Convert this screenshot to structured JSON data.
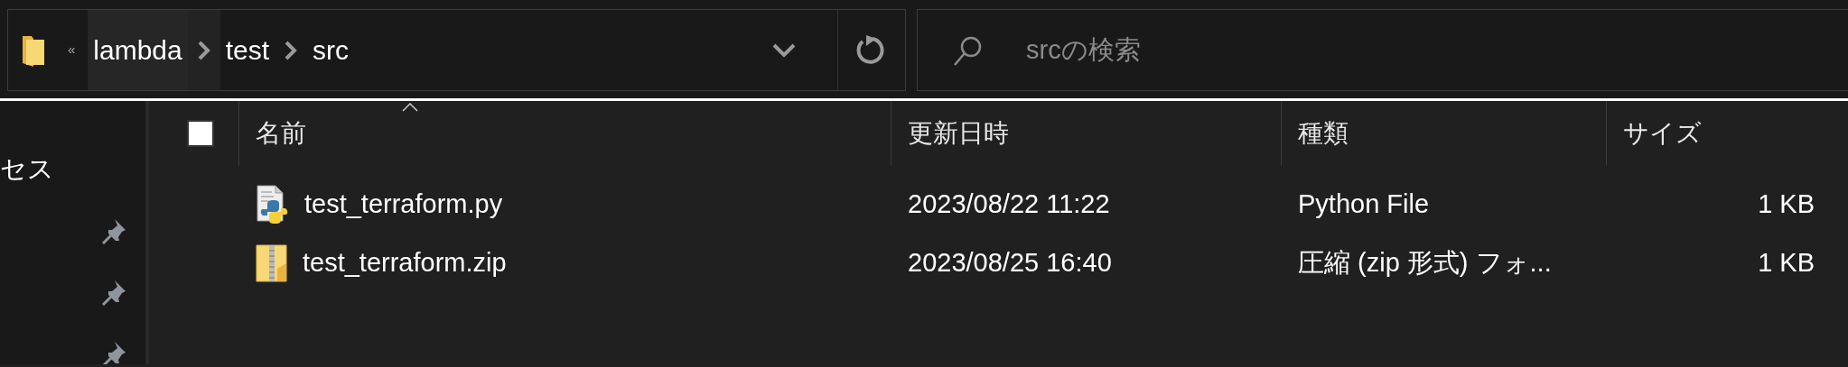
{
  "address_bar": {
    "overflow": "«",
    "breadcrumbs": [
      {
        "label": "lambda",
        "hovered": true
      },
      {
        "label": "test",
        "hovered": false
      },
      {
        "label": "src",
        "hovered": false
      }
    ]
  },
  "search": {
    "placeholder": "srcの検索"
  },
  "sidebar": {
    "items": [
      {
        "label": "セス",
        "pinned": false
      },
      {
        "pinned": true
      },
      {
        "pinned": true
      },
      {
        "pinned": true
      }
    ]
  },
  "select_all": {
    "checked": false
  },
  "columns": [
    {
      "label": "名前",
      "sorted": true
    },
    {
      "label": "更新日時",
      "sorted": false
    },
    {
      "label": "種類",
      "sorted": false
    },
    {
      "label": "サイズ",
      "sorted": false
    }
  ],
  "rows": [
    {
      "kind": "python",
      "name": "test_terraform.py",
      "modified": "2023/08/22 11:22",
      "type": "Python File",
      "size": "1 KB"
    },
    {
      "kind": "zip",
      "name": "test_terraform.zip",
      "modified": "2023/08/25 16:40",
      "type": "圧縮 (zip 形式) フォ...",
      "size": "1 KB"
    }
  ]
}
